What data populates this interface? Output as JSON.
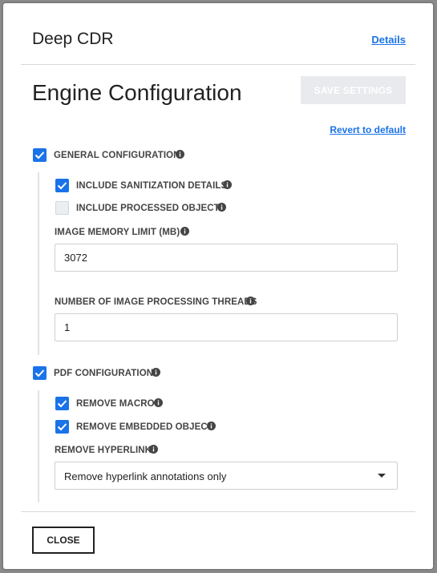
{
  "modal": {
    "title": "Deep CDR",
    "details_link": "Details",
    "close_label": "CLOSE"
  },
  "engine": {
    "title": "Engine Configuration",
    "save_label": "SAVE SETTINGS",
    "revert_label": "Revert to default"
  },
  "general": {
    "label": "GENERAL CONFIGURATION",
    "checked": true,
    "include_sanitization": {
      "label": "INCLUDE SANITIZATION DETAILS",
      "checked": true
    },
    "include_processed": {
      "label": "INCLUDE PROCESSED OBJECTS",
      "checked": false
    },
    "image_memory": {
      "label": "IMAGE MEMORY LIMIT (MB)",
      "value": "3072"
    },
    "image_threads": {
      "label": "NUMBER OF IMAGE PROCESSING THREADS",
      "value": "1"
    }
  },
  "pdf": {
    "label": "PDF CONFIGURATION",
    "checked": true,
    "remove_macro": {
      "label": "REMOVE MACRO",
      "checked": true
    },
    "remove_embedded": {
      "label": "REMOVE EMBEDDED OBJECT",
      "checked": true
    },
    "remove_hyperlink": {
      "label": "REMOVE HYPERLINK",
      "selected": "Remove hyperlink annotations only"
    }
  },
  "colors": {
    "accent": "#1a73e8",
    "disabled_button": "#e8eaed"
  },
  "icons": [
    "info-icon",
    "checkmark-icon",
    "chevron-down-icon"
  ]
}
